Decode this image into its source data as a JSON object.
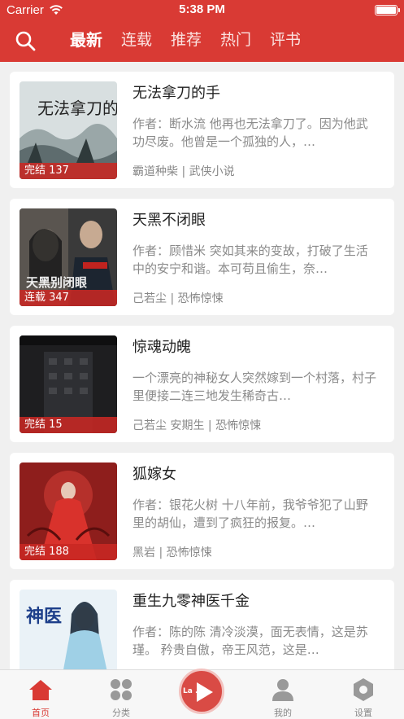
{
  "status_bar": {
    "carrier": "Carrier",
    "time": "5:38 PM"
  },
  "nav": {
    "tabs": [
      "最新",
      "连载",
      "推荐",
      "热门",
      "评书"
    ],
    "active_tab": "最新",
    "search_icon": "search-icon"
  },
  "books": [
    {
      "title": "无法拿刀的手",
      "badge": "完结 137",
      "desc": "作者：断水流 他再也无法拿刀了。因为他武功尽废。他曾是一个孤独的人，…",
      "meta": "霸道种柴 | 武侠小说",
      "cover_text": "无法拿刀的手"
    },
    {
      "title": "天黑不闭眼",
      "badge": "连载 347",
      "desc": "作者：顾惜米 突如其来的变故，打破了生活中的安宁和谐。本可苟且偷生，奈…",
      "meta": "己若尘 | 恐怖惊悚",
      "cover_text": "天黑别闭眼"
    },
    {
      "title": "惊魂动魄",
      "badge": "完结 15",
      "desc": "一个漂亮的神秘女人突然嫁到一个村落，村子里便接二连三地发生稀奇古…",
      "meta": "己若尘 安期生 | 恐怖惊悚",
      "cover_text": ""
    },
    {
      "title": "狐嫁女",
      "badge": "完结 188",
      "desc": "作者：银花火树 十八年前，我爷爷犯了山野里的胡仙，遭到了疯狂的报复。…",
      "meta": "黑岩 | 恐怖惊悚",
      "cover_text": ""
    },
    {
      "title": "重生九零神医千金",
      "badge": "",
      "desc": "作者：陈的陈 清冷淡漠，面无表情，这是苏瑾。 矜贵自傲，帝王风范，这是…",
      "meta": "",
      "cover_text": "神医"
    }
  ],
  "tabbar": {
    "items": [
      {
        "label": "首页",
        "icon": "home-icon",
        "active": true
      },
      {
        "label": "分类",
        "icon": "category-icon",
        "active": false
      },
      {
        "label": "我的",
        "icon": "profile-icon",
        "active": false
      },
      {
        "label": "设置",
        "icon": "settings-icon",
        "active": false
      }
    ],
    "center_text": "La    .tv",
    "center_icon": "play-icon"
  },
  "colors": {
    "brand_red": "#d93a34",
    "badge_red": "#c82823",
    "text_dark": "#222222",
    "text_gray": "#8a8a8a",
    "background": "#f0f0f0"
  }
}
